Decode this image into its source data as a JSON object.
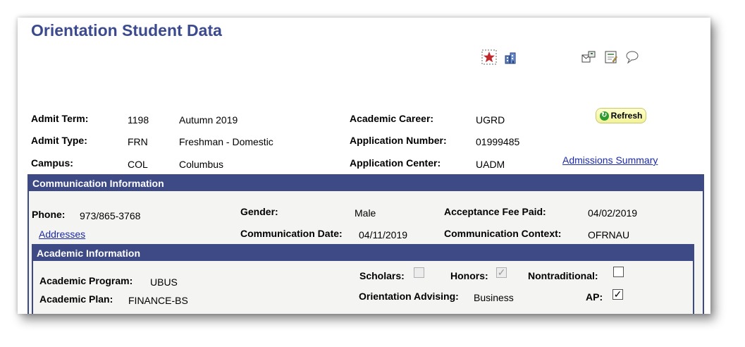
{
  "page": {
    "title": "Orientation Student Data"
  },
  "icons": [
    "favorite-star-icon",
    "campus-building-icon",
    "notify-icon",
    "edit-note-icon",
    "comment-bubble-icon"
  ],
  "header": {
    "admit_term_label": "Admit Term:",
    "admit_term_code": "1198",
    "admit_term_desc": "Autumn 2019",
    "admit_type_label": "Admit Type:",
    "admit_type_code": "FRN",
    "admit_type_desc": "Freshman - Domestic",
    "campus_label": "Campus:",
    "campus_code": "COL",
    "campus_desc": "Columbus",
    "academic_career_label": "Academic Career:",
    "academic_career_value": "UGRD",
    "application_number_label": "Application Number:",
    "application_number_value": "01999485",
    "application_center_label": "Application Center:",
    "application_center_value": "UADM",
    "refresh_label": "Refresh",
    "admissions_summary_link": "Admissions Summary"
  },
  "communication": {
    "header": "Communication Information",
    "phone_label": "Phone:",
    "phone_value": "973/865-3768",
    "addresses_link": "Addresses",
    "gender_label": "Gender:",
    "gender_value": "Male",
    "comm_date_label": "Communication Date:",
    "comm_date_value": "04/11/2019",
    "acceptance_fee_label": "Acceptance Fee Paid:",
    "acceptance_fee_value": "04/02/2019",
    "comm_context_label": "Communication Context:",
    "comm_context_value": "OFRNAU"
  },
  "academic": {
    "header": "Academic Information",
    "program_label": "Academic Program:",
    "program_value": "UBUS",
    "plan_label": "Academic Plan:",
    "plan_value": "FINANCE-BS",
    "scholars_label": "Scholars:",
    "honors_label": "Honors:",
    "nontraditional_label": "Nontraditional:",
    "orientation_advising_label": "Orientation Advising:",
    "orientation_advising_value": "Business",
    "ap_label": "AP:",
    "scholars_checked": false,
    "honors_checked": true,
    "nontraditional_checked": false,
    "ap_checked": true,
    "check_mark": "✓"
  }
}
